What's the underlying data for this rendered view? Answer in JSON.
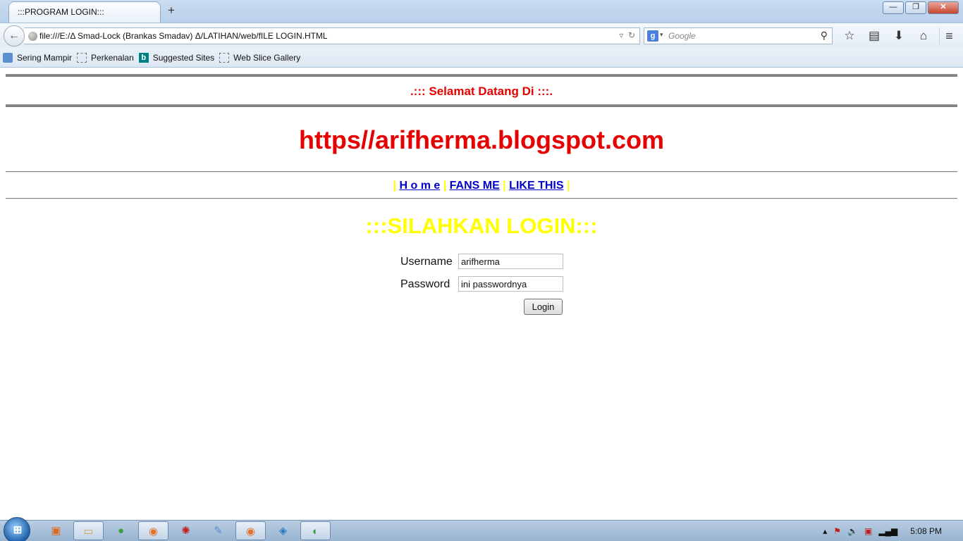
{
  "browser": {
    "tab_title": ":::PROGRAM LOGIN:::",
    "new_tab": "+",
    "url": "file:///E:/Δ Smad-Lock (Brankas Smadav) Δ/LATIHAN/web/fILE LOGIN.HTML",
    "search_placeholder": "Google",
    "search_engine_letter": "g",
    "window_buttons": {
      "minimize": "—",
      "restore": "❐",
      "close": "✕"
    },
    "bookmarks": [
      {
        "label": "Sering Mampir"
      },
      {
        "label": "Perkenalan"
      },
      {
        "label": "Suggested Sites"
      },
      {
        "label": "Web Slice Gallery"
      }
    ]
  },
  "page": {
    "welcome": ".::: Selamat Datang Di :::.",
    "site_title": "https//arifherma.blogspot.com",
    "menu": {
      "separator": "|",
      "items": [
        {
          "label": "H o m e"
        },
        {
          "label": "FANS ME"
        },
        {
          "label": "LIKE THIS"
        }
      ]
    },
    "login_heading": ":::SILAHKAN LOGIN:::",
    "username_label": "Username",
    "username_value": "arifherma",
    "password_label": "Password",
    "password_value": "ini passwordnya",
    "login_button": "Login"
  },
  "taskbar": {
    "clock": "5:08 PM"
  },
  "colors": {
    "welcome_red": "#e60000",
    "login_yellow": "#ffff00",
    "link_blue": "#0000cc"
  }
}
